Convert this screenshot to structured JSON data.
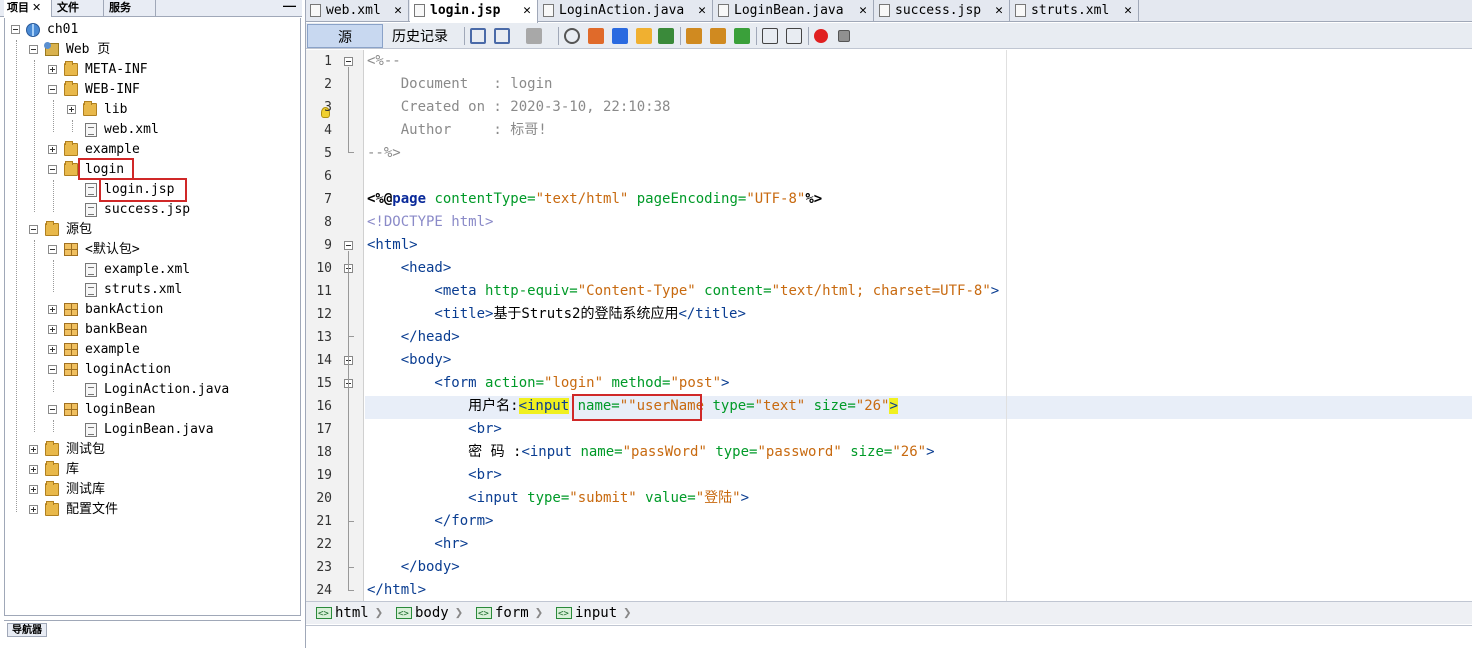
{
  "left_panel": {
    "tabs": [
      {
        "label": "项目",
        "close": "✕"
      },
      {
        "label": "文件"
      },
      {
        "label": "服务"
      }
    ],
    "minimize": "—",
    "tree": [
      {
        "label": "ch01"
      },
      {
        "label": "Web 页"
      },
      {
        "label": "META-INF"
      },
      {
        "label": "WEB-INF"
      },
      {
        "label": "lib"
      },
      {
        "label": "web.xml"
      },
      {
        "label": "example"
      },
      {
        "label": "login"
      },
      {
        "label": "login.jsp"
      },
      {
        "label": "success.jsp"
      },
      {
        "label": "源包"
      },
      {
        "label": "<默认包>"
      },
      {
        "label": "example.xml"
      },
      {
        "label": "struts.xml"
      },
      {
        "label": "bankAction"
      },
      {
        "label": "bankBean"
      },
      {
        "label": "example"
      },
      {
        "label": "loginAction"
      },
      {
        "label": "LoginAction.java"
      },
      {
        "label": "loginBean"
      },
      {
        "label": "LoginBean.java"
      },
      {
        "label": "测试包"
      },
      {
        "label": "库"
      },
      {
        "label": "测试库"
      },
      {
        "label": "配置文件"
      }
    ],
    "navigator_tab": "导航器"
  },
  "editor": {
    "tabs": [
      {
        "label": "web.xml",
        "close": "✕"
      },
      {
        "label": "login.jsp",
        "close": "✕"
      },
      {
        "label": "LoginAction.java",
        "close": "✕"
      },
      {
        "label": "LoginBean.java",
        "close": "✕"
      },
      {
        "label": "success.jsp",
        "close": "✕"
      },
      {
        "label": "struts.xml",
        "close": "✕"
      }
    ],
    "toolbar": {
      "source": "源",
      "history": "历史记录"
    },
    "line_numbers": [
      "1",
      "2",
      "3",
      "4",
      "5",
      "6",
      "7",
      "8",
      "9",
      "10",
      "11",
      "12",
      "13",
      "14",
      "15",
      "16",
      "17",
      "18",
      "19",
      "20",
      "21",
      "22",
      "23",
      "24"
    ],
    "code": {
      "l1": "<%--",
      "l2": "    Document   : login",
      "l3": "    Created on : 2020-3-10, 22:10:38",
      "l4": "    Author     : 标哥!",
      "l5": "--%>",
      "l7a": "<%@",
      "l7b": "page",
      "l7c": " contentType=",
      "l7d": "\"text/html\"",
      "l7e": " pageEncoding=",
      "l7f": "\"UTF-8\"",
      "l7g": "%>",
      "l8": "<!DOCTYPE html>",
      "l9": "<html>",
      "l10": "    <head>",
      "l11a": "        <meta",
      "l11b": " http-equiv=",
      "l11c": "\"Content-Type\"",
      "l11d": " content=",
      "l11e": "\"text/html; charset=UTF-8\"",
      "l11f": ">",
      "l12a": "        <title>",
      "l12b": "基于Struts2的登陆系统应用",
      "l12c": "</title>",
      "l13": "    </head>",
      "l14": "    <body>",
      "l15a": "        <form",
      "l15b": " action=",
      "l15c": "\"login\"",
      "l15d": " method=",
      "l15e": "\"post\"",
      "l15f": ">",
      "l16a": "            用户名:",
      "l16b": "<input",
      "l16c": " name=",
      "l16d": "\"\"userName",
      "l16e": " type=",
      "l16f": "\"text\"",
      "l16g": " size=",
      "l16h": "\"26\"",
      "l16i": ">",
      "l17": "            <br>",
      "l18a": "            密 码 :",
      "l18b": "<input",
      "l18c": " name=",
      "l18d": "\"passWord\"",
      "l18e": " type=",
      "l18f": "\"password\"",
      "l18g": " size=",
      "l18h": "\"26\"",
      "l18i": ">",
      "l19": "            <br>",
      "l20a": "            <input",
      "l20b": " type=",
      "l20c": "\"submit\"",
      "l20d": " value=",
      "l20e": "\"登陆\"",
      "l20f": ">",
      "l21": "        </form>",
      "l22": "        <hr>",
      "l23": "    </body>",
      "l24": "</html>"
    },
    "breadcrumb": [
      "html",
      "body",
      "form",
      "input"
    ]
  },
  "colors": {
    "highlight_box": "#d02828",
    "current_line": "#e8eef8",
    "match_highlight": "#f0f020"
  }
}
